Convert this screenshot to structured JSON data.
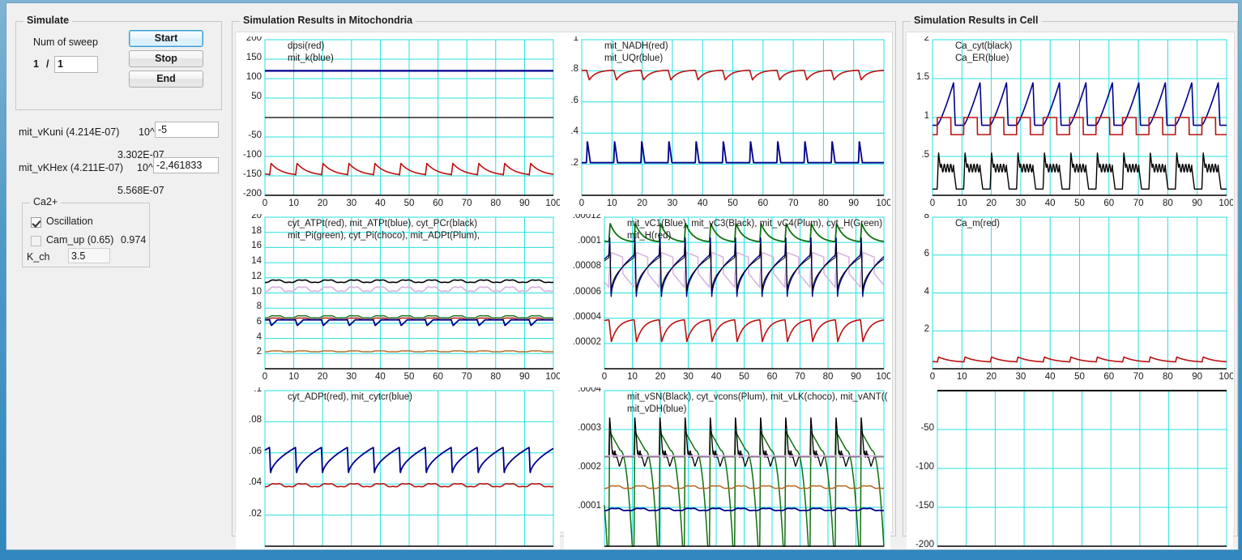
{
  "simulate": {
    "group_title": "Simulate",
    "num_sweep_label": "Num of sweep",
    "sweep_current": "1",
    "sweep_sep": "/",
    "sweep_total": "1",
    "start_label": "Start",
    "stop_label": "Stop",
    "end_label": "End"
  },
  "params": [
    {
      "label": "mit_vKuni (4.214E-07)",
      "exp_label": "10^",
      "value": "-5",
      "result": "3.302E-07"
    },
    {
      "label": "mit_vKHex (4.211E-07)",
      "exp_label": "10^",
      "value": "-2,461833",
      "result": "5.568E-07"
    }
  ],
  "ca_group": {
    "title": "Ca2+",
    "oscillation_label": "Oscillation",
    "oscillation_checked": true,
    "cam_up_label": "Cam_up (0.65)",
    "cam_up_checked": false,
    "cam_up_value": "0.974",
    "k_ch_label": "K_ch",
    "k_ch_value": "3.5"
  },
  "panels": {
    "mitochondria_title": "Simulation Results in Mitochondria",
    "cell_title": "Simulation Results in Cell"
  },
  "colors": {
    "red": "#bb1111",
    "blue": "#00008b",
    "black": "#000000",
    "green": "#107010",
    "choco": "#b5651d",
    "plum": "#d8b6e0",
    "grid": "#25e0e0",
    "axis": "#000000"
  },
  "chart_data": [
    {
      "id": "dpsi",
      "type": "line",
      "title": "dpsi(red), mit_k(blue)",
      "legend": [
        "dpsi(red)",
        "mit_k(blue)"
      ],
      "xlabel": "",
      "ylabel": "",
      "xlim": [
        0,
        100
      ],
      "ylim": [
        -200,
        200
      ],
      "xticks": [
        0,
        10,
        20,
        30,
        40,
        50,
        60,
        70,
        80,
        90,
        100
      ],
      "yticks": [
        200,
        150,
        100,
        50,
        0,
        -50,
        -100,
        -150,
        -200
      ],
      "ytick_labels": [
        "200",
        "150",
        "100",
        "50",
        "",
        "-50",
        "-100",
        "-150",
        "-200"
      ],
      "grid": true,
      "period": 9.0,
      "series": [
        {
          "name": "mit_k",
          "color": "blue",
          "shape": "flat",
          "level": 120,
          "width": 2.2
        },
        {
          "name": "zero",
          "color": "black",
          "shape": "flat",
          "level": 0,
          "width": 1.2
        },
        {
          "name": "dpsi",
          "color": "red",
          "shape": "spike_decay",
          "base": -150,
          "peak": -118,
          "decay": 0.42,
          "rise": 0.06,
          "width": 1.6
        }
      ]
    },
    {
      "id": "nadh",
      "type": "line",
      "title": "mit_NADH(red), mit_UQr(blue)",
      "legend": [
        "mit_NADH(red)",
        "mit_UQr(blue)"
      ],
      "xlim": [
        0,
        100
      ],
      "ylim": [
        0,
        1
      ],
      "xticks": [
        0,
        10,
        20,
        30,
        40,
        50,
        60,
        70,
        80,
        90,
        100
      ],
      "yticks": [
        1,
        0.8,
        0.6,
        0.4,
        0.2
      ],
      "ytick_labels": [
        "1",
        ".8",
        ".6",
        ".4",
        ".2"
      ],
      "grid": true,
      "period": 9.0,
      "series": [
        {
          "name": "mit_NADH",
          "color": "red",
          "shape": "sawtooth_drop",
          "base": 0.805,
          "trough": 0.742,
          "drop": 0.1,
          "recover": 0.55,
          "width": 1.6
        },
        {
          "name": "mit_UQr",
          "color": "blue",
          "shape": "pulse",
          "base": 0.21,
          "peak": 0.35,
          "rise": 0.03,
          "fall": 0.11,
          "width": 1.8
        }
      ]
    },
    {
      "id": "atp",
      "type": "line",
      "title": "cyt_ATPt(red), mit_ATPt(blue), cyt_PCr(black)\nmit_Pi(green), cyt_Pi(choco), mit_ADPt(Plum),",
      "legend": [
        "cyt_ATPt(red), mit_ATPt(blue), cyt_PCr(black)",
        "mit_Pi(green), cyt_Pi(choco), mit_ADPt(Plum),"
      ],
      "xlim": [
        0,
        100
      ],
      "ylim": [
        0,
        20
      ],
      "xticks": [
        0,
        10,
        20,
        30,
        40,
        50,
        60,
        70,
        80,
        90,
        100
      ],
      "yticks": [
        20,
        18,
        16,
        14,
        12,
        10,
        8,
        6,
        4,
        2
      ],
      "ytick_labels": [
        "20",
        "18",
        "16",
        "14",
        "12",
        "10",
        "8",
        "6",
        "4",
        "2"
      ],
      "grid": true,
      "period": 9.0,
      "series": [
        {
          "name": "cyt_PCr",
          "color": "black",
          "shape": "ripple",
          "level": 11.55,
          "amp": 0.2,
          "width": 1.6
        },
        {
          "name": "mit_ADPt",
          "color": "plum",
          "shape": "ripple",
          "level": 10.5,
          "amp": 0.35,
          "width": 1.8
        },
        {
          "name": "mit_Pi",
          "color": "green",
          "shape": "ripple",
          "level": 6.85,
          "amp": 0.18,
          "width": 1.4
        },
        {
          "name": "cyt_ATPt",
          "color": "red",
          "shape": "ripple",
          "level": 6.6,
          "amp": 0.12,
          "width": 1.4
        },
        {
          "name": "mit_ATPt",
          "color": "blue",
          "shape": "notch",
          "base": 6.45,
          "trough": 5.7,
          "width": 1.8
        },
        {
          "name": "cyt_Pi",
          "color": "choco",
          "shape": "ripple",
          "level": 2.3,
          "amp": 0.08,
          "width": 1.4
        }
      ]
    },
    {
      "id": "vc1",
      "type": "line",
      "title": "mit_vC1(Blue), mit_vC3(Black), mit_vC4(Plum), cyt_H(Green)\nmit_H(red)",
      "legend": [
        "mit_vC1(Blue), mit_vC3(Black), mit_vC4(Plum), cyt_H(Green)",
        "mit_H(red)"
      ],
      "xlim": [
        0,
        100
      ],
      "ylim": [
        0,
        0.00012
      ],
      "xticks": [
        0,
        10,
        20,
        30,
        40,
        50,
        60,
        70,
        80,
        90,
        100
      ],
      "yticks": [
        0.00012,
        0.0001,
        8e-05,
        6e-05,
        4e-05,
        2e-05
      ],
      "ytick_labels": [
        ".00012",
        ".0001",
        ".00008",
        ".00006",
        ".00004",
        ".00002"
      ],
      "grid": true,
      "period": 9.0,
      "series": [
        {
          "name": "cyt_H",
          "color": "green",
          "shape": "spike_decay_up",
          "base": 0.0001,
          "peak": 0.000115,
          "decay": 0.3,
          "width": 1.8
        },
        {
          "name": "mit_vC4",
          "color": "plum",
          "shape": "hump",
          "base": 7.2e-05,
          "peak": 9.2e-05,
          "width": 1.6
        },
        {
          "name": "mit_vC1",
          "color": "blue",
          "shape": "sharp_v",
          "base": 9e-05,
          "trough": 5.5e-05,
          "spike": 0.000105,
          "width": 1.4
        },
        {
          "name": "mit_vC3",
          "color": "black",
          "shape": "sharp_v",
          "base": 8.8e-05,
          "trough": 6e-05,
          "spike": 0.0001,
          "width": 1.0
        },
        {
          "name": "mit_H",
          "color": "red",
          "shape": "sawtooth_drop",
          "base": 3.95e-05,
          "trough": 2.15e-05,
          "drop": 0.1,
          "recover": 0.62,
          "width": 1.6
        }
      ]
    },
    {
      "id": "adp",
      "type": "line",
      "title": "cyt_ADPt(red), mit_cytcr(blue)",
      "legend": [
        "cyt_ADPt(red), mit_cytcr(blue)"
      ],
      "xlim": [
        0,
        100
      ],
      "ylim": [
        0,
        0.1
      ],
      "xticks": [
        0,
        10,
        20,
        30,
        40,
        50,
        60,
        70,
        80,
        90,
        100
      ],
      "yticks": [
        0.1,
        0.08,
        0.06,
        0.04,
        0.02
      ],
      "ytick_labels": [
        ".1",
        ".08",
        ".06",
        ".04",
        ".02"
      ],
      "grid": true,
      "period": 9.0,
      "series": [
        {
          "name": "mit_cytcr",
          "color": "blue",
          "shape": "drop_recover",
          "base": 0.0635,
          "trough": 0.0465,
          "width": 1.8
        },
        {
          "name": "cyt_ADPt",
          "color": "red",
          "shape": "ripple",
          "level": 0.0392,
          "amp": 0.0012,
          "width": 1.6
        }
      ]
    },
    {
      "id": "vsn",
      "type": "line",
      "title": "mit_vSN(Black), cyt_vcons(Plum), mit_vLK(choco), mit_vANT((\nmit_vDH(blue)",
      "legend": [
        "mit_vSN(Black), cyt_vcons(Plum), mit_vLK(choco), mit_vANT((",
        "mit_vDH(blue)"
      ],
      "xlim": [
        0,
        100
      ],
      "ylim": [
        0,
        0.0004
      ],
      "xticks": [
        0,
        10,
        20,
        30,
        40,
        50,
        60,
        70,
        80,
        90,
        100
      ],
      "yticks": [
        0.0004,
        0.0003,
        0.0002,
        0.0001
      ],
      "ytick_labels": [
        ".0004",
        ".0003",
        ".0002",
        ".0001"
      ],
      "grid": true,
      "period": 9.0,
      "series": [
        {
          "name": "mit_vANT",
          "color": "green",
          "shape": "deep_sweep",
          "base": 0.00028,
          "peak": 0.000295,
          "bottom": 0.0,
          "width": 1.5
        },
        {
          "name": "mit_vSN",
          "color": "black",
          "shape": "spike_wobble",
          "base": 0.00023,
          "peak": 0.000335,
          "trough": 0.000205,
          "width": 1.3
        },
        {
          "name": "cyt_vcons",
          "color": "plum",
          "shape": "flat",
          "level": 0.000232,
          "width": 2.0
        },
        {
          "name": "mit_vLK",
          "color": "choco",
          "shape": "ripple",
          "level": 0.000152,
          "amp": 4e-06,
          "width": 1.5
        },
        {
          "name": "mit_vDH",
          "color": "blue",
          "shape": "ripple",
          "level": 9.45e-05,
          "amp": 3.5e-06,
          "width": 1.8
        }
      ]
    },
    {
      "id": "cacyt",
      "type": "line",
      "title": "Ca_cyt(black), Ca_ER(blue)",
      "legend": [
        "Ca_cyt(black)",
        "Ca_ER(blue)"
      ],
      "xlim": [
        0,
        100
      ],
      "ylim": [
        0,
        2
      ],
      "xticks": [
        0,
        10,
        20,
        30,
        40,
        50,
        60,
        70,
        80,
        90,
        100
      ],
      "yticks": [
        2,
        1.5,
        1,
        0.5
      ],
      "ytick_labels": [
        "2",
        "1.5",
        "1",
        ".5"
      ],
      "grid": true,
      "period": 9.0,
      "series": [
        {
          "name": "Ca_ER",
          "color": "blue",
          "shape": "ramp_drop",
          "base": 0.9,
          "peak": 1.45,
          "width": 1.6
        },
        {
          "name": "Ca_square",
          "color": "red",
          "shape": "square",
          "low": 0.78,
          "high": 1.0,
          "duty": 0.52,
          "width": 1.6
        },
        {
          "name": "Ca_cyt",
          "color": "black",
          "shape": "burst",
          "base": 0.08,
          "peak": 0.55,
          "plateau": 0.35,
          "width": 1.4
        }
      ]
    },
    {
      "id": "cam",
      "type": "line",
      "title": "Ca_m(red)",
      "legend": [
        "Ca_m(red)"
      ],
      "xlim": [
        0,
        100
      ],
      "ylim": [
        0,
        8
      ],
      "xticks": [
        0,
        10,
        20,
        30,
        40,
        50,
        60,
        70,
        80,
        90,
        100
      ],
      "yticks": [
        8,
        6,
        4,
        2
      ],
      "ytick_labels": [
        "8",
        "6",
        "4",
        "2"
      ],
      "grid": true,
      "period": 9.0,
      "series": [
        {
          "name": "Ca_m",
          "color": "red",
          "shape": "spike_decay_up",
          "base": 0.33,
          "peak": 0.62,
          "decay": 0.45,
          "width": 1.6
        }
      ]
    },
    {
      "id": "empty",
      "type": "line",
      "title": "",
      "legend": [],
      "xlim": [
        0,
        100
      ],
      "ylim": [
        -200,
        0
      ],
      "xticks": [
        0,
        10,
        20,
        30,
        40,
        50,
        60,
        70,
        80,
        90,
        100
      ],
      "yticks": [
        0,
        -50,
        -100,
        -150,
        -200
      ],
      "ytick_labels": [
        "",
        "-50",
        "-100",
        "-150",
        "-200"
      ],
      "grid": true,
      "period": 9.0,
      "series": [
        {
          "name": "top",
          "color": "black",
          "shape": "flat",
          "level": 0,
          "width": 2.0
        }
      ]
    }
  ]
}
